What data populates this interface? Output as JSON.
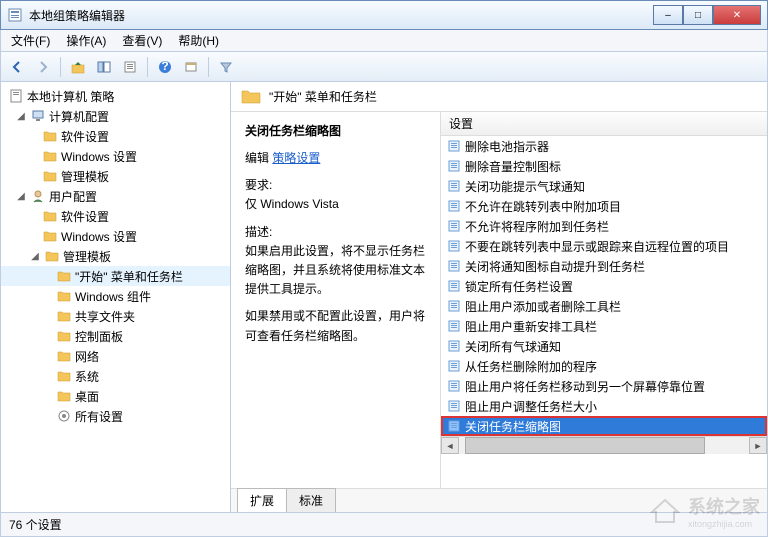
{
  "window": {
    "title": "本地组策略编辑器",
    "buttons": {
      "min": "–",
      "max": "□",
      "close": "✕"
    }
  },
  "menu": {
    "items": [
      "文件(F)",
      "操作(A)",
      "查看(V)",
      "帮助(H)"
    ]
  },
  "tree": {
    "root": "本地计算机 策略",
    "computer": {
      "label": "计算机配置",
      "children": [
        "软件设置",
        "Windows 设置",
        "管理模板"
      ]
    },
    "user": {
      "label": "用户配置",
      "software": "软件设置",
      "windows": "Windows 设置",
      "admin": {
        "label": "管理模板",
        "children": [
          "\"开始\" 菜单和任务栏",
          "Windows 组件",
          "共享文件夹",
          "控制面板",
          "网络",
          "系统",
          "桌面",
          "所有设置"
        ]
      }
    }
  },
  "crumb": {
    "title": "\"开始\" 菜单和任务栏"
  },
  "detail": {
    "heading": "关闭任务栏缩略图",
    "edit_prefix": "编辑",
    "edit_link": "策略设置",
    "req_label": "要求:",
    "req_value": "仅 Windows Vista",
    "desc_label": "描述:",
    "desc_1": "如果启用此设置，将不显示任务栏缩略图，并且系统将使用标准文本提供工具提示。",
    "desc_2": "如果禁用或不配置此设置，用户将可查看任务栏缩略图。"
  },
  "list": {
    "header": "设置",
    "items": [
      "删除电池指示器",
      "删除音量控制图标",
      "关闭功能提示气球通知",
      "不允许在跳转列表中附加项目",
      "不允许将程序附加到任务栏",
      "不要在跳转列表中显示或跟踪来自远程位置的项目",
      "关闭将通知图标自动提升到任务栏",
      "锁定所有任务栏设置",
      "阻止用户添加或者删除工具栏",
      "阻止用户重新安排工具栏",
      "关闭所有气球通知",
      "从任务栏删除附加的程序",
      "阻止用户将任务栏移动到另一个屏幕停靠位置",
      "阻止用户调整任务栏大小",
      "关闭任务栏缩略图"
    ],
    "selected_index": 14
  },
  "tabs": {
    "extended": "扩展",
    "standard": "标准"
  },
  "status": {
    "count": "76 个设置"
  },
  "watermark": {
    "text": "系统之家",
    "sub": "xitongzhijia.com"
  }
}
